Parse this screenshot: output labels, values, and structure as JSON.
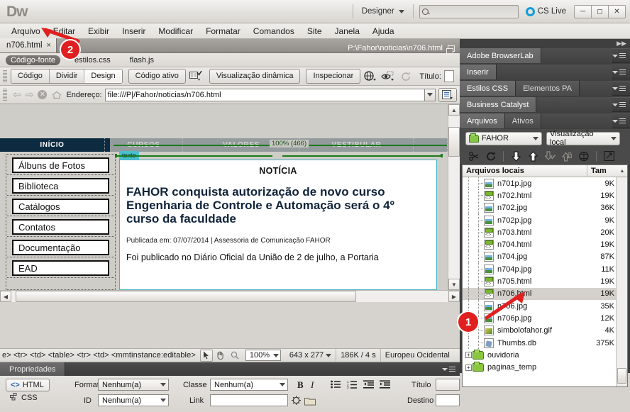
{
  "app": {
    "logo": "Dw",
    "workspace": "Designer",
    "search_placeholder": "",
    "cs_live": "CS Live",
    "window_buttons": [
      "minimize",
      "maximize",
      "close"
    ]
  },
  "menubar": {
    "items": [
      "Arquivo",
      "Editar",
      "Exibir",
      "Inserir",
      "Modificar",
      "Formatar",
      "Comandos",
      "Site",
      "Janela",
      "Ajuda"
    ]
  },
  "document": {
    "tab_title": "n706.html",
    "tab_close": "×",
    "path": "P:\\Fahor\\noticias\\n706.html",
    "related_files": [
      {
        "label": "Código-fonte",
        "active": true
      },
      {
        "label": "estilos.css",
        "active": false
      },
      {
        "label": "flash.js",
        "active": false
      }
    ]
  },
  "toolbar": {
    "view_buttons": [
      {
        "label": "Código",
        "active": false
      },
      {
        "label": "Dividir",
        "active": false
      },
      {
        "label": "Design",
        "active": true
      }
    ],
    "live_code": "Código ativo",
    "live_view": "Visualização dinâmica",
    "inspect": "Inspecionar",
    "title_label": "Título:",
    "title_value": ""
  },
  "addressbar": {
    "label": "Endereço:",
    "value": "file:///P|/Fahor/noticias/n706.html"
  },
  "canvas": {
    "zoom_ruler_label": "100% (466)",
    "site_nav": [
      "INÍCIO",
      "CURSOS",
      "VALORES",
      "VESTIBULAR"
    ],
    "left_menu": [
      "Álbuns de Fotos",
      "Biblioteca",
      "Catálogos",
      "Contatos",
      "Documentação",
      "EAD"
    ],
    "region_tag": "texto",
    "article": {
      "kicker": "NOTÍCIA",
      "headline": "FAHOR conquista autorização de novo curso Engenharia de Controle e Automação será o 4º curso da faculdade",
      "meta": "Publicada em: 07/07/2014 | Assessoria de Comunicação FAHOR",
      "body": "Foi publicado no Diário Oficial da União de 2 de julho, a Portaria"
    }
  },
  "statusbar": {
    "tag_selector": "e> <tr> <td> <table> <tr> <td> <mmtinstance:editable>",
    "tools": [
      "pointer-tool",
      "hand-tool",
      "zoom-tool"
    ],
    "zoom": "100%",
    "window_size": "643 x 277",
    "download": "186K / 4 s",
    "encoding": "Europeu Ocidental"
  },
  "properties": {
    "panel_title": "Propriedades",
    "mode_html": "HTML",
    "mode_css": "CSS",
    "format_label": "Formato",
    "format_value": "Nenhum(a)",
    "id_label": "ID",
    "id_value": "Nenhum(a)",
    "class_label": "Classe",
    "class_value": "Nenhum(a)",
    "link_label": "Link",
    "link_value": "",
    "bold": "B",
    "italic": "I",
    "title_label": "Título",
    "title_value": "",
    "target_label": "Destino",
    "target_value": ""
  },
  "right_panels": {
    "browserlab": "Adobe BrowserLab",
    "inserir": "Inserir",
    "css_tabs": [
      {
        "label": "Estilos CSS",
        "selected": true
      },
      {
        "label": "Elementos PA",
        "selected": false
      }
    ],
    "business_catalyst": "Business Catalyst",
    "files_tabs": [
      {
        "label": "Arquivos",
        "selected": true
      },
      {
        "label": "Ativos",
        "selected": false
      }
    ],
    "site_select": "FAHOR",
    "view_select": "Visualização local",
    "columns": {
      "name": "Arquivos locais",
      "size": "Tam"
    },
    "rows": [
      {
        "name": "n701p.jpg",
        "size": "9K",
        "icon": "image-file-icon",
        "level": 2,
        "selected": false
      },
      {
        "name": "n702.html",
        "size": "19K",
        "icon": "html-file-icon",
        "level": 2,
        "selected": false
      },
      {
        "name": "n702.jpg",
        "size": "36K",
        "icon": "image-file-icon",
        "level": 2,
        "selected": false
      },
      {
        "name": "n702p.jpg",
        "size": "9K",
        "icon": "image-file-icon",
        "level": 2,
        "selected": false
      },
      {
        "name": "n703.html",
        "size": "20K",
        "icon": "html-file-icon",
        "level": 2,
        "selected": false
      },
      {
        "name": "n704.html",
        "size": "19K",
        "icon": "html-file-icon",
        "level": 2,
        "selected": false
      },
      {
        "name": "n704.jpg",
        "size": "87K",
        "icon": "image-file-icon",
        "level": 2,
        "selected": false
      },
      {
        "name": "n704p.jpg",
        "size": "11K",
        "icon": "image-file-icon",
        "level": 2,
        "selected": false
      },
      {
        "name": "n705.html",
        "size": "19K",
        "icon": "html-file-icon",
        "level": 2,
        "selected": false
      },
      {
        "name": "n706.html",
        "size": "19K",
        "icon": "html-file-icon",
        "level": 2,
        "selected": true
      },
      {
        "name": "n706.jpg",
        "size": "35K",
        "icon": "image-file-icon",
        "level": 2,
        "selected": false
      },
      {
        "name": "n706p.jpg",
        "size": "12K",
        "icon": "image-file-icon",
        "level": 2,
        "selected": false
      },
      {
        "name": "simbolofahor.gif",
        "size": "4K",
        "icon": "gif-file-icon",
        "level": 2,
        "selected": false
      },
      {
        "name": "Thumbs.db",
        "size": "375K",
        "icon": "db-file-icon",
        "level": 2,
        "selected": false
      },
      {
        "name": "ouvidoria",
        "size": "",
        "icon": "folder-icon",
        "level": 1,
        "selected": false
      },
      {
        "name": "paginas_temp",
        "size": "",
        "icon": "folder-icon",
        "level": 1,
        "selected": false
      }
    ]
  },
  "callouts": [
    {
      "number": "1",
      "points_to": "n706.html file row"
    },
    {
      "number": "2",
      "points_to": "Arquivo menu"
    }
  ]
}
